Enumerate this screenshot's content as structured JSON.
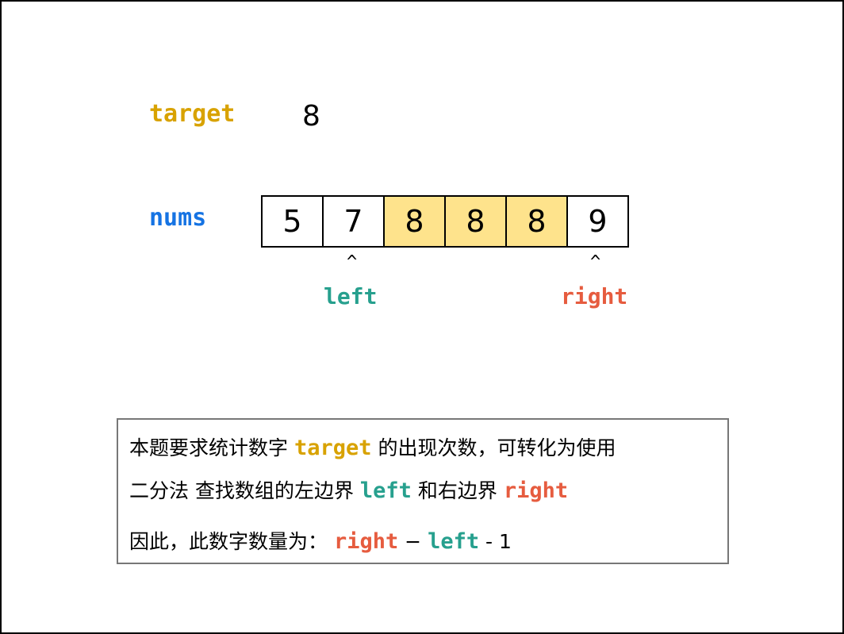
{
  "colors": {
    "target": "#d8a200",
    "nums": "#1573e3",
    "left": "#27a08e",
    "right": "#e65c3f",
    "highlight": "#fee38c"
  },
  "target": {
    "label": "target",
    "value": "8"
  },
  "nums": {
    "label": "nums",
    "values": [
      "5",
      "7",
      "8",
      "8",
      "8",
      "9"
    ],
    "highlighted": [
      false,
      false,
      true,
      true,
      true,
      false
    ]
  },
  "pointers": {
    "caret": "^",
    "left": "left",
    "right": "right"
  },
  "explanation": {
    "line1": {
      "a": "本题要求统计数字 ",
      "target": "target",
      "b": " 的出现次数，可转化为使用"
    },
    "line2": {
      "a": "二分法 查找数组的左边界 ",
      "left": "left",
      "b": " 和右边界 ",
      "right": "right"
    },
    "line3": {
      "a": "因此，此数字数量为： ",
      "right": "right",
      "b": " − ",
      "left": "left",
      "c": " - 1"
    }
  }
}
